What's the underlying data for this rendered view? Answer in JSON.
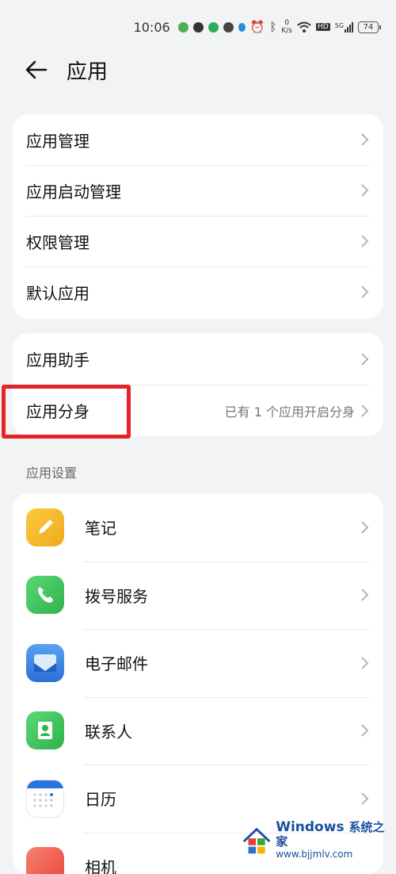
{
  "status_bar": {
    "time": "10:06",
    "net_speed_value": "0",
    "net_speed_unit": "K/s",
    "hd": "HD",
    "signal": "5G",
    "battery": "74"
  },
  "header": {
    "title": "应用"
  },
  "group1": {
    "items": [
      {
        "label": "应用管理"
      },
      {
        "label": "应用启动管理"
      },
      {
        "label": "权限管理"
      },
      {
        "label": "默认应用"
      }
    ]
  },
  "group2": {
    "items": [
      {
        "label": "应用助手",
        "value": ""
      },
      {
        "label": "应用分身",
        "value": "已有 1 个应用开启分身"
      }
    ]
  },
  "section": {
    "title": "应用设置"
  },
  "apps": [
    {
      "label": "笔记",
      "icon": "notes-icon",
      "color": "#f5b82e"
    },
    {
      "label": "拨号服务",
      "icon": "phone-icon",
      "color": "#3ec15a"
    },
    {
      "label": "电子邮件",
      "icon": "email-icon",
      "color": "#2f7de1"
    },
    {
      "label": "联系人",
      "icon": "contacts-icon",
      "color": "#3ec15a"
    },
    {
      "label": "日历",
      "icon": "calendar-icon",
      "color": "#ffffff"
    },
    {
      "label": "相机",
      "icon": "camera-icon",
      "color": "#f05b4f"
    }
  ],
  "watermark": {
    "brand": "Windows",
    "brand_cn": "系统之家",
    "url": "www.bjjmlv.com"
  },
  "colors": {
    "background": "#f1f3f5",
    "card": "#ffffff",
    "highlight": "#e5232a"
  }
}
